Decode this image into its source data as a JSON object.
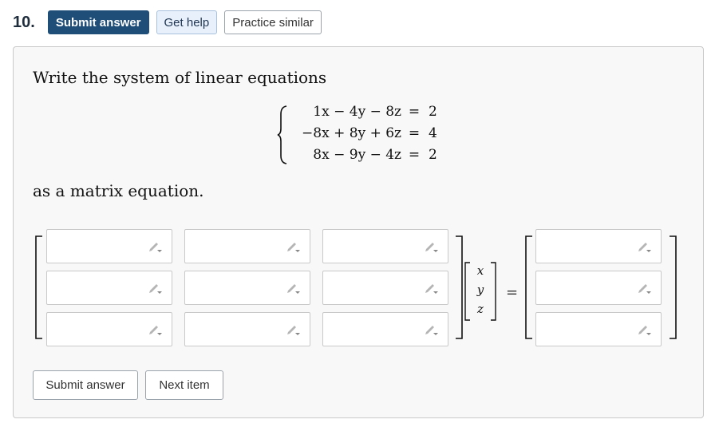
{
  "question": {
    "number": "10.",
    "buttons": {
      "submit": "Submit answer",
      "help": "Get help",
      "practice": "Practice similar"
    }
  },
  "prompt": {
    "intro": "Write the system of linear equations",
    "outro": "as a matrix equation."
  },
  "system": {
    "equations": [
      {
        "lhs": "1x − 4y − 8z",
        "sign": "=",
        "rhs": "2"
      },
      {
        "lhs": "−8x + 8y + 6z",
        "sign": "=",
        "rhs": "4"
      },
      {
        "lhs": "8x − 9y − 4z",
        "sign": "=",
        "rhs": "2"
      }
    ]
  },
  "matrix": {
    "coefficient_cells": [
      "",
      "",
      "",
      "",
      "",
      "",
      "",
      "",
      ""
    ],
    "variables": [
      "x",
      "y",
      "z"
    ],
    "equals": "=",
    "constant_cells": [
      "",
      "",
      ""
    ],
    "edit_icon": "pencil-icon"
  },
  "footer": {
    "submit": "Submit answer",
    "next": "Next item"
  },
  "colors": {
    "primary": "#1f4e79",
    "help_bg": "#e8f1fb",
    "card_bg": "#f8f8f8",
    "border": "#c9c9c9"
  }
}
